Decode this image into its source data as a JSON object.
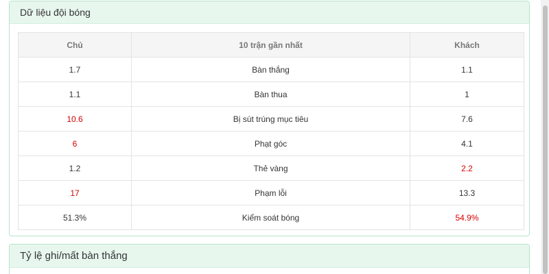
{
  "team_data_panel": {
    "title": "Dữ liệu đội bóng",
    "headers": {
      "home": "Chủ",
      "stat": "10 trận gần nhất",
      "away": "Khách"
    },
    "rows": [
      {
        "home": "1.7",
        "stat": "Bàn thắng",
        "away": "1.1",
        "home_highlight": false,
        "away_highlight": false
      },
      {
        "home": "1.1",
        "stat": "Bàn thua",
        "away": "1",
        "home_highlight": false,
        "away_highlight": false
      },
      {
        "home": "10.6",
        "stat": "Bị sút trúng mục tiêu",
        "away": "7.6",
        "home_highlight": true,
        "away_highlight": false
      },
      {
        "home": "6",
        "stat": "Phạt góc",
        "away": "4.1",
        "home_highlight": true,
        "away_highlight": false
      },
      {
        "home": "1.2",
        "stat": "Thẻ vàng",
        "away": "2.2",
        "home_highlight": false,
        "away_highlight": true
      },
      {
        "home": "17",
        "stat": "Phạm lỗi",
        "away": "13.3",
        "home_highlight": true,
        "away_highlight": false
      },
      {
        "home": "51.3%",
        "stat": "Kiểm soát bóng",
        "away": "54.9%",
        "home_highlight": false,
        "away_highlight": true
      }
    ]
  },
  "score_ratio_panel": {
    "title": "Tỷ lệ ghi/mất bàn thắng"
  },
  "colors": {
    "highlight": "#d40000",
    "header_bg": "#e7f7ee",
    "border": "#b6e3c8"
  }
}
